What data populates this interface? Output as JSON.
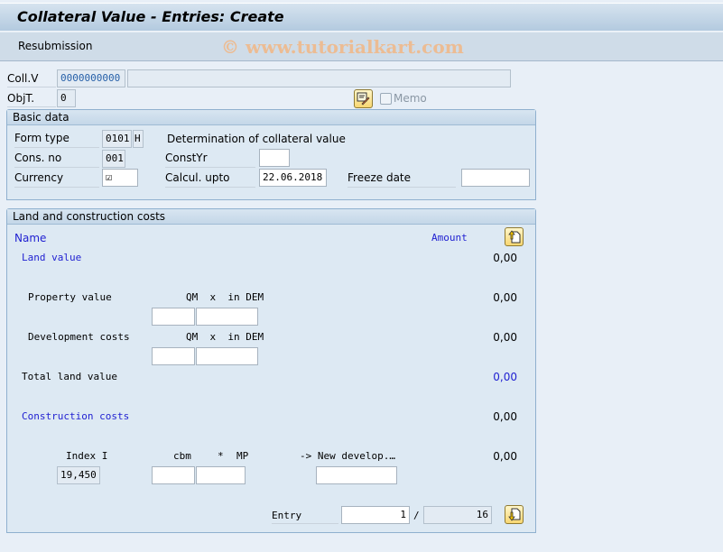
{
  "window": {
    "title": "Collateral Value - Entries: Create"
  },
  "toolbar": {
    "resubmission_label": "Resubmission",
    "watermark": "© www.tutorialkart.com"
  },
  "header": {
    "collv_label": "Coll.V",
    "collv_value": "0000000000",
    "collv_desc": "",
    "objt_label": "ObjT.",
    "objt_value": "0",
    "memo_label": "Memo",
    "memo_checked": false,
    "memo_icon": "note-edit-icon"
  },
  "basic_data": {
    "title": "Basic data",
    "form_type_label": "Form type",
    "form_type_value": "0101",
    "form_type_suffix": "H",
    "form_type_desc": "Determination of collateral value",
    "cons_no_label": "Cons. no",
    "cons_no_value": "001",
    "constyr_label": "ConstYr",
    "constyr_value": "",
    "currency_label": "Currency",
    "currency_value": "☑",
    "calcul_label": "Calcul. upto",
    "calcul_value": "22.06.2018",
    "freeze_label": "Freeze date",
    "freeze_value": ""
  },
  "land_costs": {
    "title": "Land and construction costs",
    "col_name": "Name",
    "col_amount": "Amount",
    "land_value_label": "Land value",
    "land_value_amount": "0,00",
    "property_label": "Property value",
    "property_units": "QM  x  in DEM",
    "property_amount": "0,00",
    "property_qm": "",
    "property_price": "",
    "development_label": "Development costs",
    "development_units": "QM  x  in DEM",
    "development_amount": "0,00",
    "development_qm": "",
    "development_price": "",
    "total_land_label": "Total land value",
    "total_land_amount": "0,00",
    "construction_label": "Construction costs",
    "construction_amount": "0,00",
    "index_label": "Index I",
    "index_value": "19,450",
    "cbm_label": "cbm",
    "mult_label": "*",
    "mp_label": "MP",
    "newdev_label": "-> New develop.…",
    "newdev_amount": "0,00",
    "cbm_value": "",
    "mp_value": "",
    "newdev_value": "",
    "entry_label": "Entry",
    "entry_value": "1",
    "entry_sep": "/",
    "entry_total": "16"
  },
  "colors": {
    "accent_blue": "#1f1fd1",
    "panel_bg": "#dde9f3",
    "page_bg": "#e8eff7"
  }
}
